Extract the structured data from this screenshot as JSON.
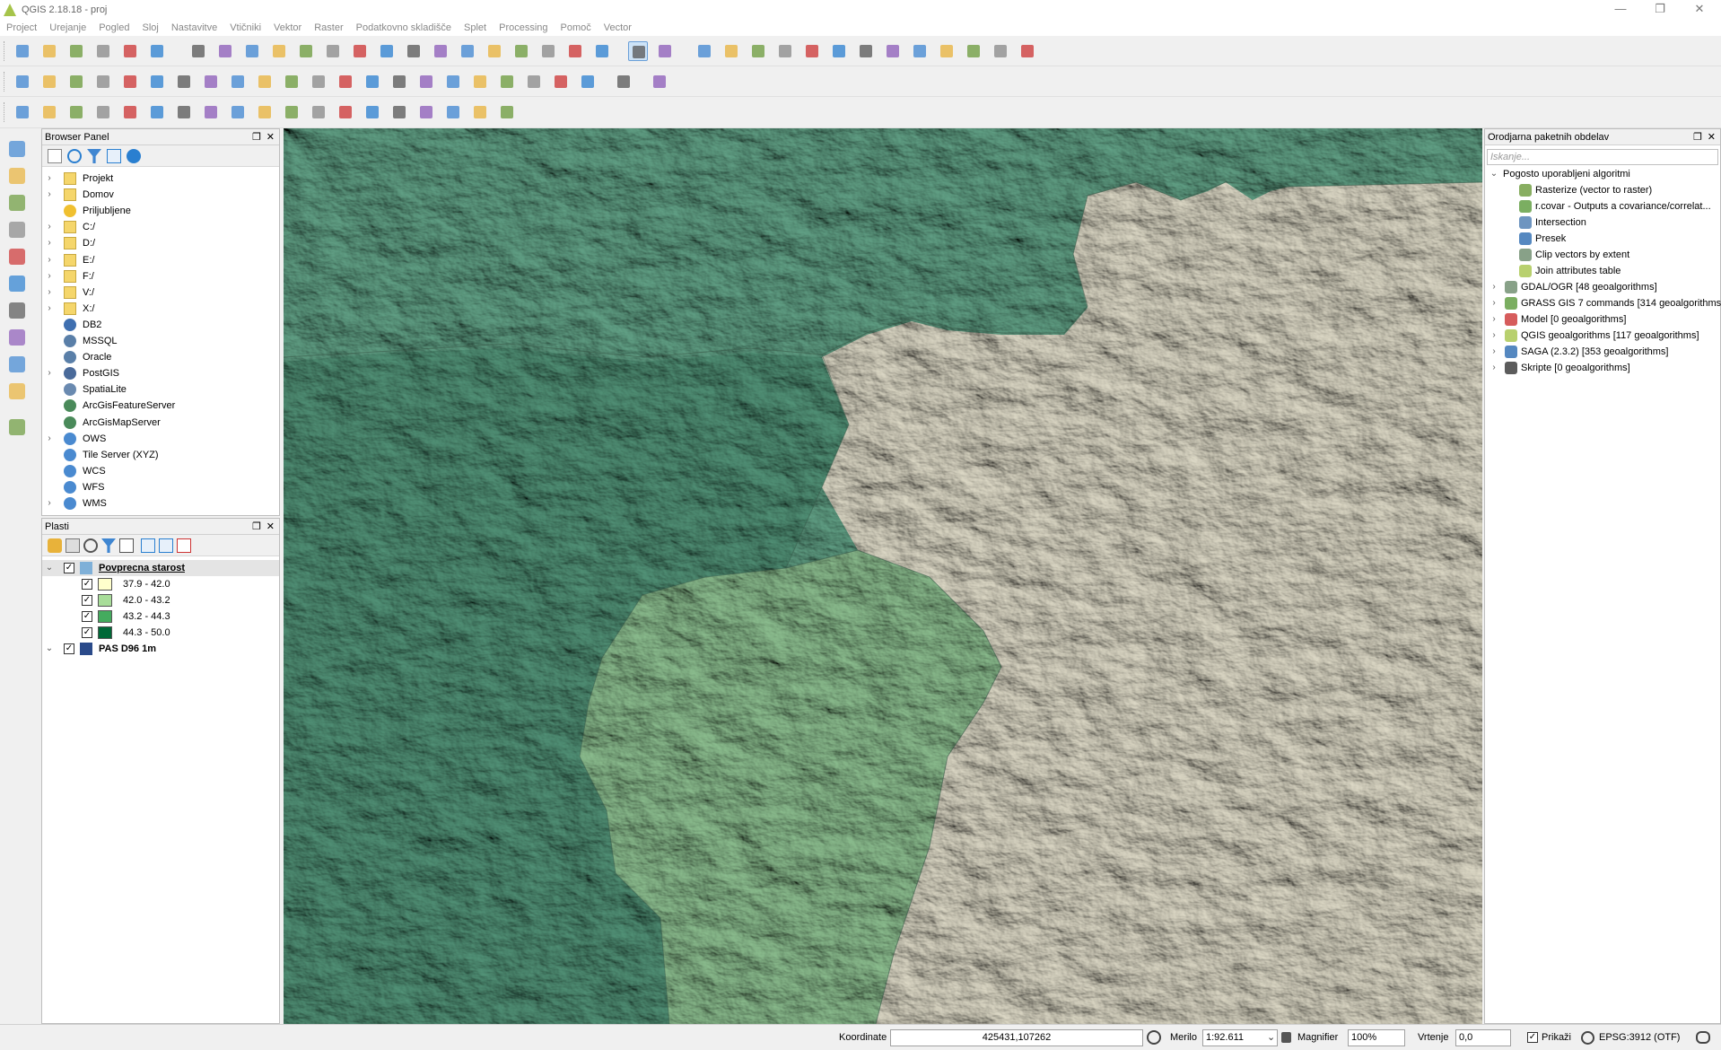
{
  "window": {
    "title": "QGIS 2.18.18 - proj"
  },
  "menu": [
    "Project",
    "Urejanje",
    "Pogled",
    "Sloj",
    "Nastavitve",
    "Vtičniki",
    "Vektor",
    "Raster",
    "Podatkovno skladišče",
    "Splet",
    "Processing",
    "Pomoč",
    "Vector"
  ],
  "browser": {
    "title": "Browser Panel",
    "items": [
      {
        "label": "Projekt",
        "expandable": true,
        "icon": "folder-icon"
      },
      {
        "label": "Domov",
        "expandable": true,
        "icon": "folder-icon"
      },
      {
        "label": "Priljubljene",
        "expandable": false,
        "icon": "star-icon"
      },
      {
        "label": "C:/",
        "expandable": true,
        "icon": "folder-icon"
      },
      {
        "label": "D:/",
        "expandable": true,
        "icon": "folder-icon"
      },
      {
        "label": "E:/",
        "expandable": true,
        "icon": "folder-icon"
      },
      {
        "label": "F:/",
        "expandable": true,
        "icon": "folder-icon"
      },
      {
        "label": "V:/",
        "expandable": true,
        "icon": "folder-icon"
      },
      {
        "label": "X:/",
        "expandable": true,
        "icon": "folder-icon"
      },
      {
        "label": "DB2",
        "expandable": false,
        "icon": "db2-icon"
      },
      {
        "label": "MSSQL",
        "expandable": false,
        "icon": "mssql-icon"
      },
      {
        "label": "Oracle",
        "expandable": false,
        "icon": "oracle-icon"
      },
      {
        "label": "PostGIS",
        "expandable": true,
        "icon": "postgis-icon"
      },
      {
        "label": "SpatiaLite",
        "expandable": false,
        "icon": "spatialite-icon"
      },
      {
        "label": "ArcGisFeatureServer",
        "expandable": false,
        "icon": "arcgis-icon"
      },
      {
        "label": "ArcGisMapServer",
        "expandable": false,
        "icon": "arcgis-icon"
      },
      {
        "label": "OWS",
        "expandable": true,
        "icon": "ows-icon"
      },
      {
        "label": "Tile Server (XYZ)",
        "expandable": false,
        "icon": "xyz-icon"
      },
      {
        "label": "WCS",
        "expandable": false,
        "icon": "wcs-icon"
      },
      {
        "label": "WFS",
        "expandable": false,
        "icon": "wfs-icon"
      },
      {
        "label": "WMS",
        "expandable": true,
        "icon": "wms-icon"
      }
    ]
  },
  "layers": {
    "title": "Plasti",
    "items": [
      {
        "label": "Povprecna starost",
        "type": "layer",
        "bold": true,
        "underline": true
      },
      {
        "label": "37.9 - 42.0",
        "type": "class",
        "color": "#ffffcc"
      },
      {
        "label": "42.0 - 43.2",
        "type": "class",
        "color": "#a8dd99"
      },
      {
        "label": "43.2 - 44.3",
        "type": "class",
        "color": "#44ab5e"
      },
      {
        "label": "44.3 - 50.0",
        "type": "class",
        "color": "#006837"
      },
      {
        "label": "PAS D96 1m",
        "type": "layer",
        "bold": true,
        "underline": false
      }
    ]
  },
  "processing": {
    "title": "Orodjarna paketnih obdelav",
    "search_placeholder": "Iskanje...",
    "recent_group": "Pogosto uporabljeni algoritmi",
    "recent": [
      {
        "label": "Rasterize (vector to raster)",
        "icon": "rasterize-icon"
      },
      {
        "label": "r.covar - Outputs a covariance/correlat...",
        "icon": "grass-icon"
      },
      {
        "label": "Intersection",
        "icon": "intersection-icon"
      },
      {
        "label": "Presek",
        "icon": "saga-icon"
      },
      {
        "label": "Clip vectors by extent",
        "icon": "gdal-icon"
      },
      {
        "label": "Join attributes table",
        "icon": "qgis-icon"
      }
    ],
    "providers": [
      {
        "label": "GDAL/OGR [48 geoalgorithms]",
        "icon": "gdal-icon"
      },
      {
        "label": "GRASS GIS 7 commands [314 geoalgorithms]",
        "icon": "grass-icon"
      },
      {
        "label": "Model [0 geoalgorithms]",
        "icon": "model-icon"
      },
      {
        "label": "QGIS geoalgorithms [117 geoalgorithms]",
        "icon": "qgis-icon"
      },
      {
        "label": "SAGA (2.3.2) [353 geoalgorithms]",
        "icon": "saga-icon"
      },
      {
        "label": "Skripte [0 geoalgorithms]",
        "icon": "script-icon"
      }
    ]
  },
  "status": {
    "coord_label": "Koordinate",
    "coord_value": "425431,107262",
    "scale_label": "Merilo",
    "scale_value": "1:92.611",
    "magnifier_label": "Magnifier",
    "magnifier_value": "100%",
    "rotation_label": "Vrtenje",
    "rotation_value": "0,0",
    "render_label": "Prikaži",
    "crs": "EPSG:3912 (OTF)"
  },
  "colors": {
    "map_green_dark": "#4a8a70",
    "map_green_mid": "#5e9a80",
    "map_green_light": "#8dbb8a",
    "map_beige": "#d6d2c0",
    "selection_blue": "#cde3f7"
  }
}
